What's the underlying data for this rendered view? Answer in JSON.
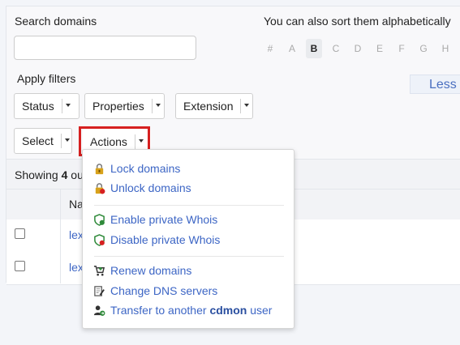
{
  "search": {
    "label": "Search domains",
    "value": "",
    "placeholder": ""
  },
  "sort": {
    "label": "You can also sort them alphabetically",
    "letters": [
      "#",
      "A",
      "B",
      "C",
      "D",
      "E",
      "F",
      "G",
      "H"
    ],
    "active": "B"
  },
  "filters": {
    "label": "Apply filters",
    "less_label": "Less",
    "status_label": "Status",
    "properties_label": "Properties",
    "extension_label": "Extension"
  },
  "toolbar": {
    "select_label": "Select",
    "actions_label": "Actions"
  },
  "summary": {
    "prefix": "Showing",
    "count": "4",
    "rest": "ou"
  },
  "table": {
    "header_name": "Na",
    "rows": [
      {
        "name": "lex"
      },
      {
        "name": "lex"
      }
    ]
  },
  "actions_menu": {
    "lock": "Lock domains",
    "unlock": "Unlock domains",
    "enable_whois": "Enable private Whois",
    "disable_whois": "Disable private Whois",
    "renew": "Renew domains",
    "change_dns": "Change DNS servers",
    "transfer_prefix": "Transfer to another",
    "transfer_brand": "cdmon",
    "transfer_suffix": "user"
  },
  "colors": {
    "accent": "#3d66c5",
    "highlight": "#d62020"
  },
  "icons": [
    "lock-icon",
    "unlock-icon",
    "shield-check-icon",
    "shield-minus-icon",
    "cart-icon",
    "edit-document-icon",
    "user-transfer-icon",
    "caret-down-icon"
  ]
}
